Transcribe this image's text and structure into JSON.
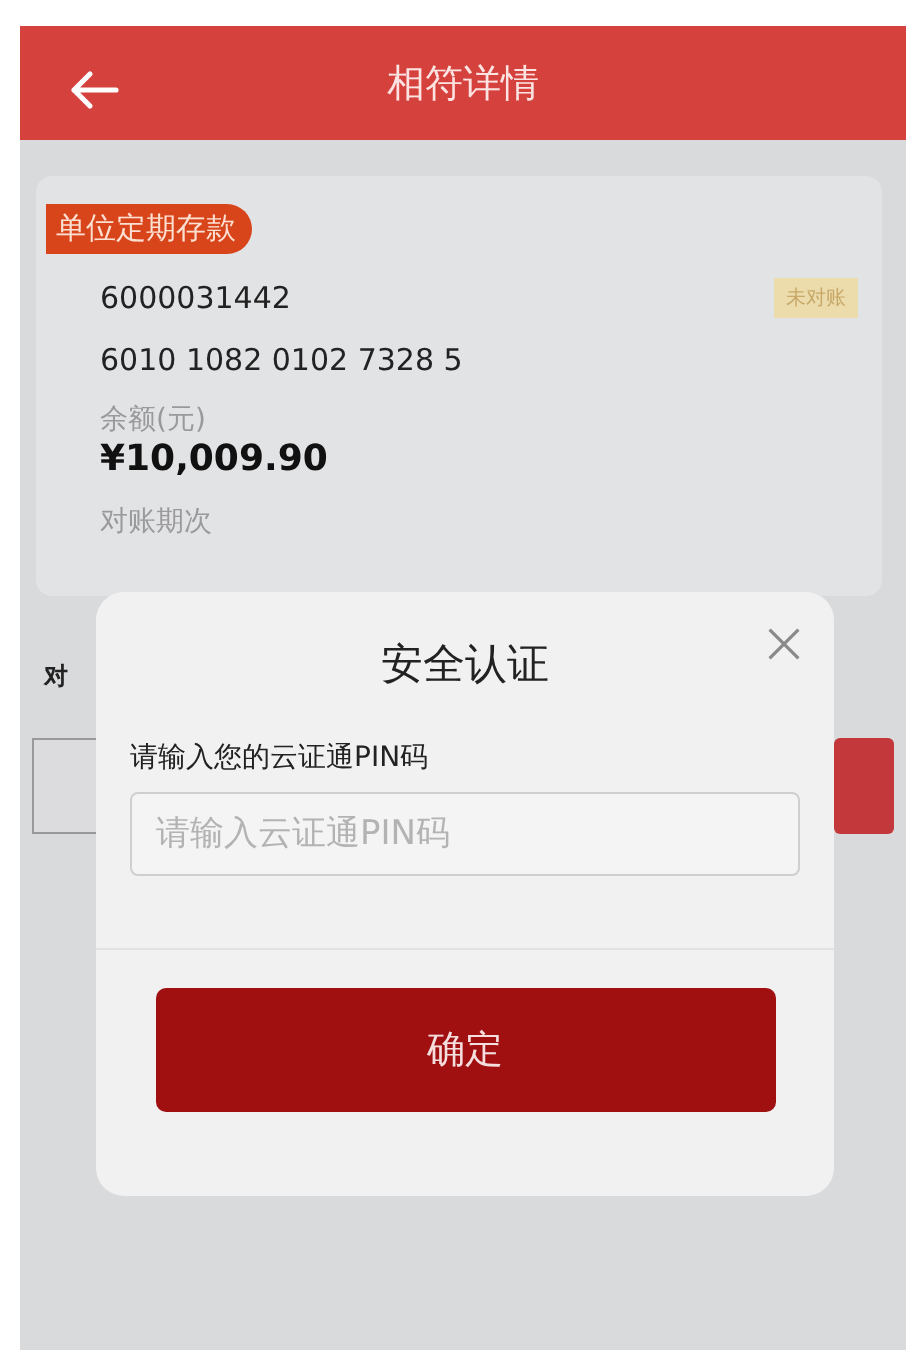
{
  "header": {
    "title": "相符详情"
  },
  "account": {
    "tag": "单位定期存款",
    "account_no": "6000031442",
    "card_no": "6010 1082 0102 7328 5",
    "status": "未对账",
    "balance_label": "余额(元)",
    "balance": "¥10,009.90",
    "period_label": "对账期次"
  },
  "section_label": "对",
  "dialog": {
    "title": "安全认证",
    "field_label": "请输入您的云证通PIN码",
    "field": {
      "placeholder": "请输入云证通PIN码"
    },
    "confirm": "确定"
  }
}
